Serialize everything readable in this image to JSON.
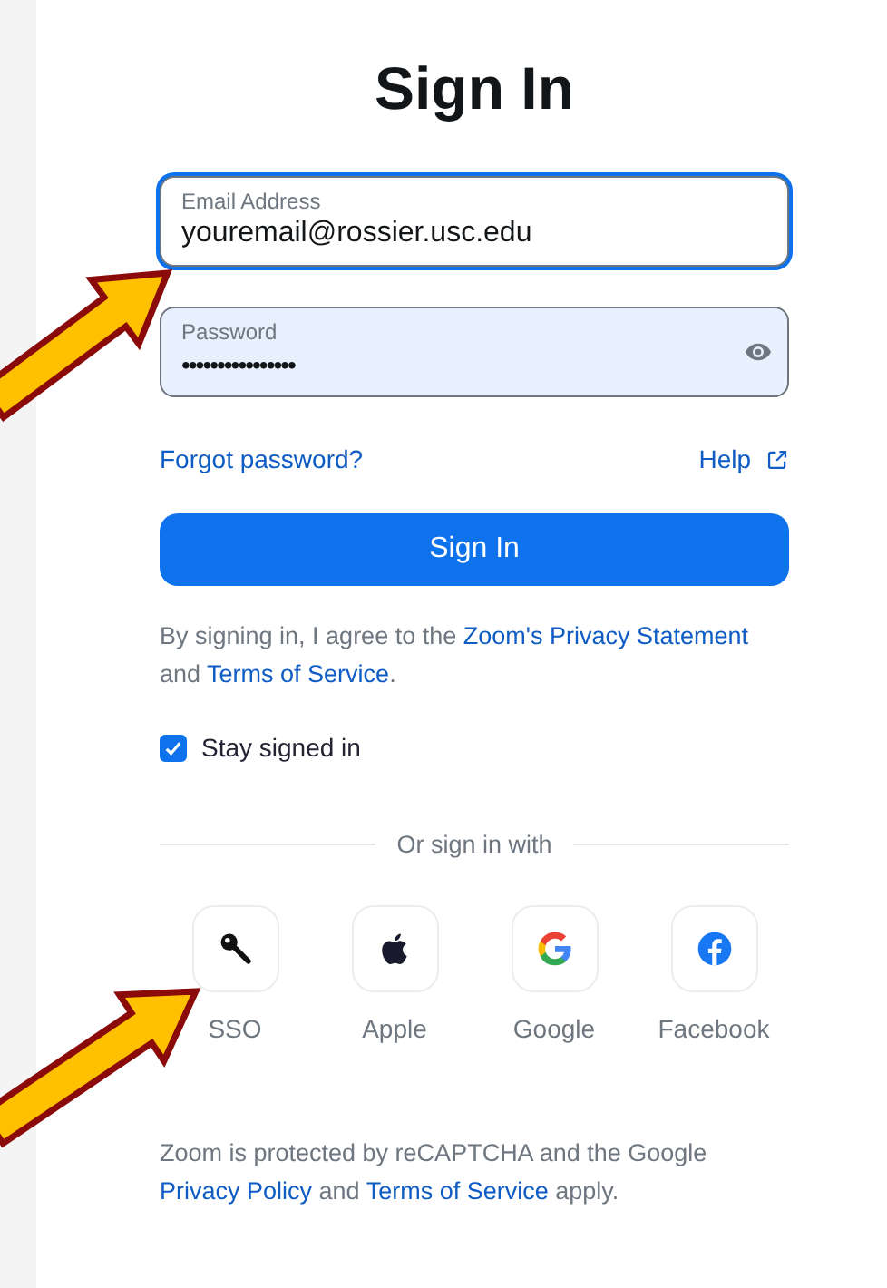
{
  "title": "Sign In",
  "fields": [
    {
      "kind": "text",
      "label": "Email Address",
      "value": "youremail@rossier.usc.edu",
      "focused": true
    },
    {
      "kind": "password",
      "label": "Password",
      "value": "••••••••••••••••",
      "focused": false
    }
  ],
  "forgot_link": "Forgot password?",
  "help_link": "Help",
  "sign_in_button": "Sign In",
  "agreement": [
    {
      "text": "By signing in, I agree to the ",
      "link": false
    },
    {
      "text": "Zoom's Privacy Statement",
      "link": true
    },
    {
      "text": " and ",
      "link": false
    },
    {
      "text": "Terms of Service",
      "link": true
    },
    {
      "text": ".",
      "link": false
    }
  ],
  "stay_signed_in": {
    "label": "Stay signed in",
    "checked": true
  },
  "divider_text": "Or sign in with",
  "providers": [
    {
      "kind": "sso",
      "label": "SSO"
    },
    {
      "kind": "apple",
      "label": "Apple"
    },
    {
      "kind": "google",
      "label": "Google"
    },
    {
      "kind": "facebook",
      "label": "Facebook"
    }
  ],
  "recaptcha": [
    {
      "text": "Zoom is protected by reCAPTCHA and the Google ",
      "link": false
    },
    {
      "text": "Privacy Policy",
      "link": true
    },
    {
      "text": " and ",
      "link": false
    },
    {
      "text": "Terms of Service",
      "link": true
    },
    {
      "text": " apply.",
      "link": false
    }
  ]
}
